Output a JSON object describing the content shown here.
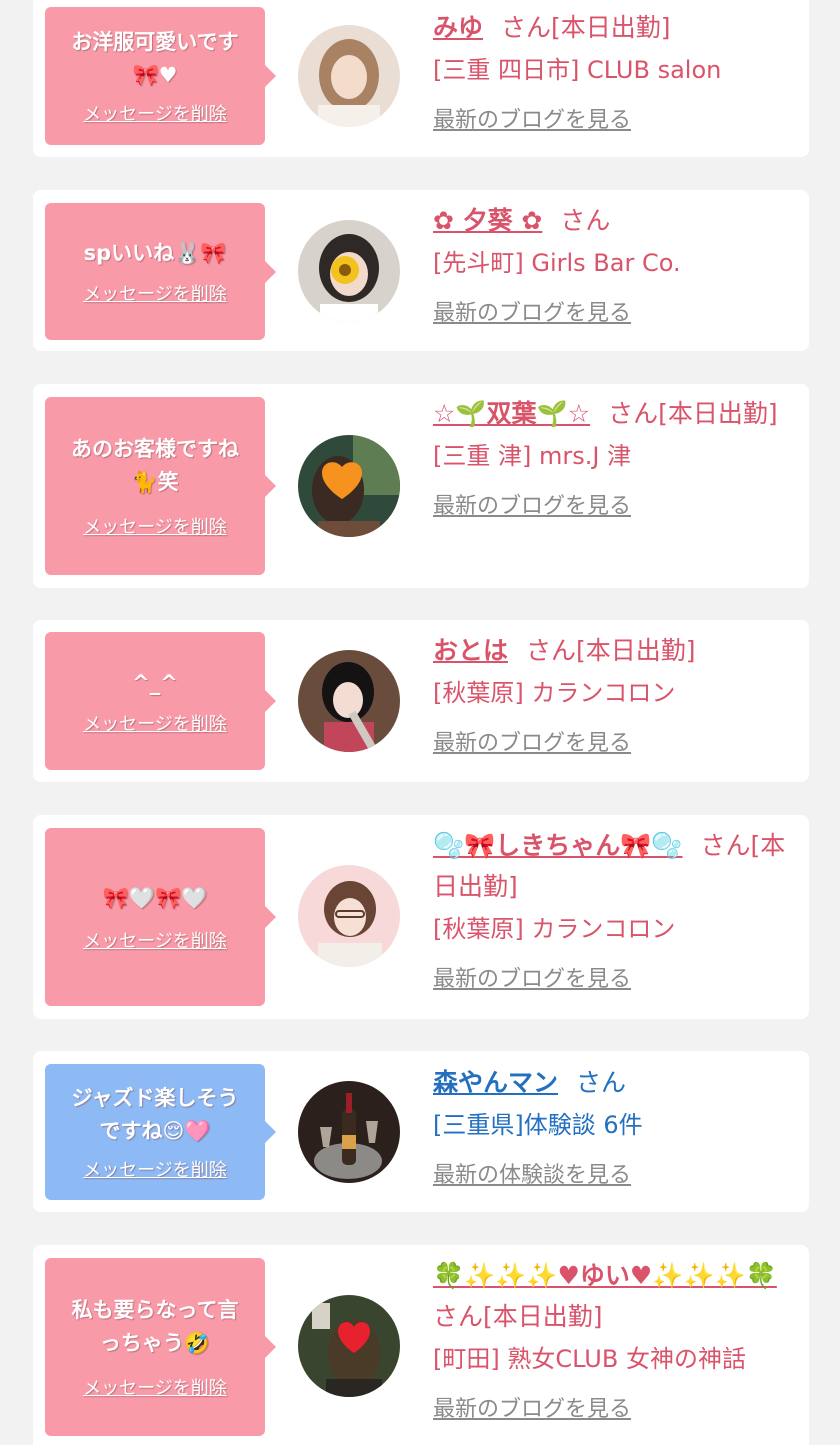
{
  "colors": {
    "background": "#f2f2f2",
    "card": "#ffffff",
    "bubble_pink": "#f99aa8",
    "bubble_blue": "#8db9f4",
    "cast_text": "#d9546a",
    "customer_text": "#2370c0",
    "link_gray": "#8a8a8a"
  },
  "messages": [
    {
      "message": "お洋服可愛いです\n🎀♥",
      "delete_label": "メッセージを削除",
      "name": "みゆ",
      "suffix": "さん[本日出勤]",
      "shop": "[三重 四日市] CLUB salon",
      "link": "最新のブログを見る",
      "bubble_color": "pink",
      "avatar_icon": "profile-photo"
    },
    {
      "message": "spいいね🐰🎀",
      "delete_label": "メッセージを削除",
      "name": "✿ 夕葵 ✿",
      "suffix": "さん",
      "shop": "[先斗町] Girls Bar Co.",
      "link": "最新のブログを見る",
      "bubble_color": "pink",
      "avatar_icon": "profile-photo"
    },
    {
      "message": "あのお客様ですね\n🐈笑",
      "delete_label": "メッセージを削除",
      "name": "☆🌱双葉🌱☆",
      "suffix": "さん[本日出勤]",
      "shop": "[三重 津] mrs.J 津",
      "link": "最新のブログを見る",
      "bubble_color": "pink",
      "avatar_icon": "profile-photo"
    },
    {
      "message": "^_^",
      "delete_label": "メッセージを削除",
      "name": "おとは",
      "suffix": "さん[本日出勤]",
      "shop": "[秋葉原] カランコロン",
      "link": "最新のブログを見る",
      "bubble_color": "pink",
      "avatar_icon": "profile-photo"
    },
    {
      "message": "🎀🤍🎀🤍",
      "delete_label": "メッセージを削除",
      "name": "🫧🎀しきちゃん🎀🫧",
      "suffix": "さん[本日出勤]",
      "shop": "[秋葉原] カランコロン",
      "link": "最新のブログを見る",
      "bubble_color": "pink",
      "avatar_icon": "profile-photo"
    },
    {
      "message": "ジャズド楽しそう\nですね😌🩷",
      "delete_label": "メッセージを削除",
      "name": "森やんマン",
      "suffix": "さん",
      "shop": "[三重県]体験談 6件",
      "link": "最新の体験談を見る",
      "bubble_color": "blue",
      "avatar_icon": "champagne-photo"
    },
    {
      "message": "私も要らなって言\nっちゃう🤣",
      "delete_label": "メッセージを削除",
      "name": "🍀✨✨✨♥ゆい♥✨✨✨🍀",
      "suffix": "さん[本日出勤]",
      "shop": "[町田] 熟女CLUB 女神の神話",
      "link": "最新のブログを見る",
      "bubble_color": "pink",
      "avatar_icon": "profile-photo"
    }
  ]
}
